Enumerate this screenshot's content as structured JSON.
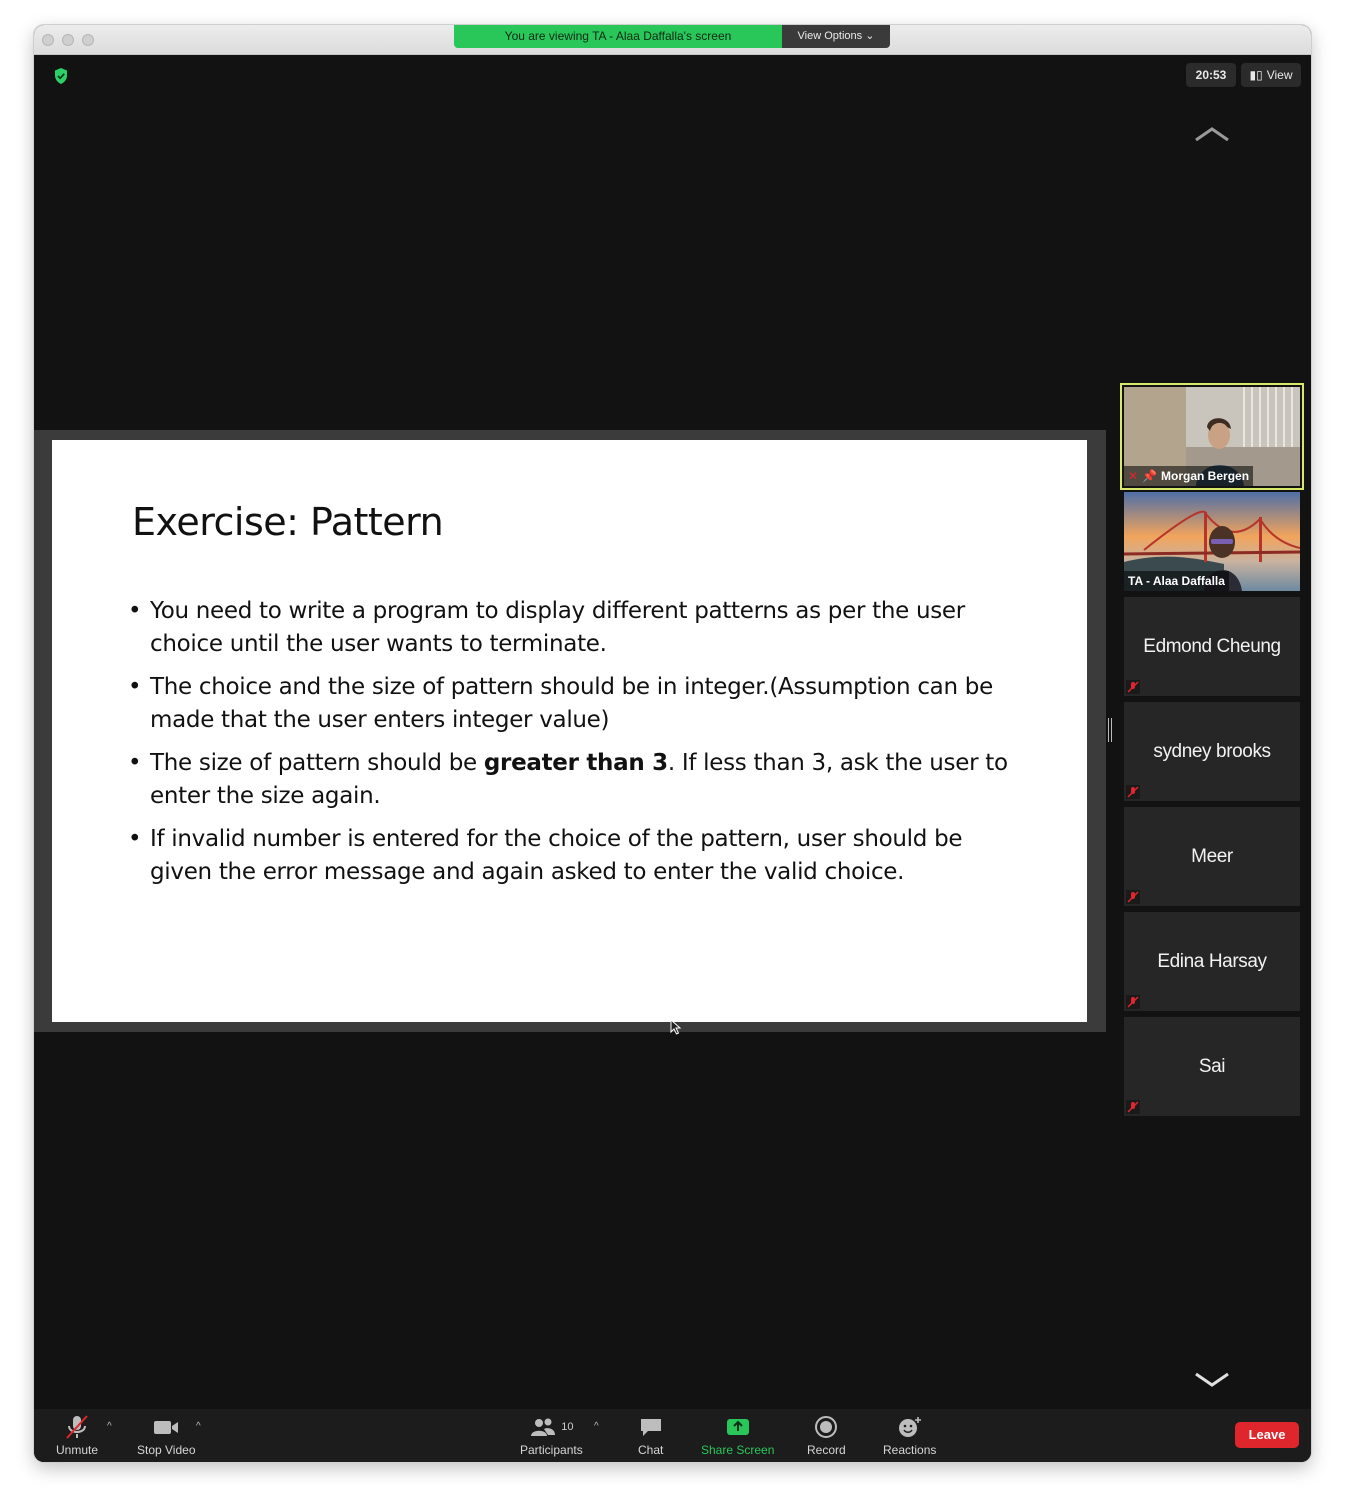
{
  "banner": {
    "text": "You are viewing TA - Alaa Daffalla's screen",
    "options_label": "View Options"
  },
  "header": {
    "time": "20:53",
    "view_label": "View"
  },
  "slide": {
    "title": "Exercise: Pattern",
    "bullets": [
      "You need to write a program to display different patterns as per the user choice until the user wants to terminate.",
      "The choice  and the size of pattern should be in integer.(Assumption can be made that the user enters integer value)",
      {
        "before": "The size of pattern should be ",
        "bold": "greater than 3",
        "after": ". If less than 3, ask the user to enter the size again."
      },
      "If invalid number is entered for the choice of the pattern, user should be given the error message and again asked to enter the valid choice."
    ]
  },
  "participants_panel": [
    {
      "name": "Morgan Bergen",
      "video": true,
      "pinned": true,
      "muted": true,
      "active": true
    },
    {
      "name": "TA - Alaa Daffalla",
      "video": true,
      "muted": false
    },
    {
      "name": "Edmond Cheung",
      "video": false,
      "muted": true
    },
    {
      "name": "sydney brooks",
      "video": false,
      "muted": true
    },
    {
      "name": "Meer",
      "video": false,
      "muted": true
    },
    {
      "name": "Edina Harsay",
      "video": false,
      "muted": true
    },
    {
      "name": "Sai",
      "video": false,
      "muted": true
    }
  ],
  "toolbar": {
    "unmute": "Unmute",
    "stop_video": "Stop Video",
    "participants": "Participants",
    "participants_count": "10",
    "chat": "Chat",
    "share_screen": "Share Screen",
    "record": "Record",
    "reactions": "Reactions",
    "leave": "Leave"
  },
  "colors": {
    "share_green": "#29c759",
    "leave_red": "#e0262d",
    "active_speaker": "#d7e86b"
  }
}
